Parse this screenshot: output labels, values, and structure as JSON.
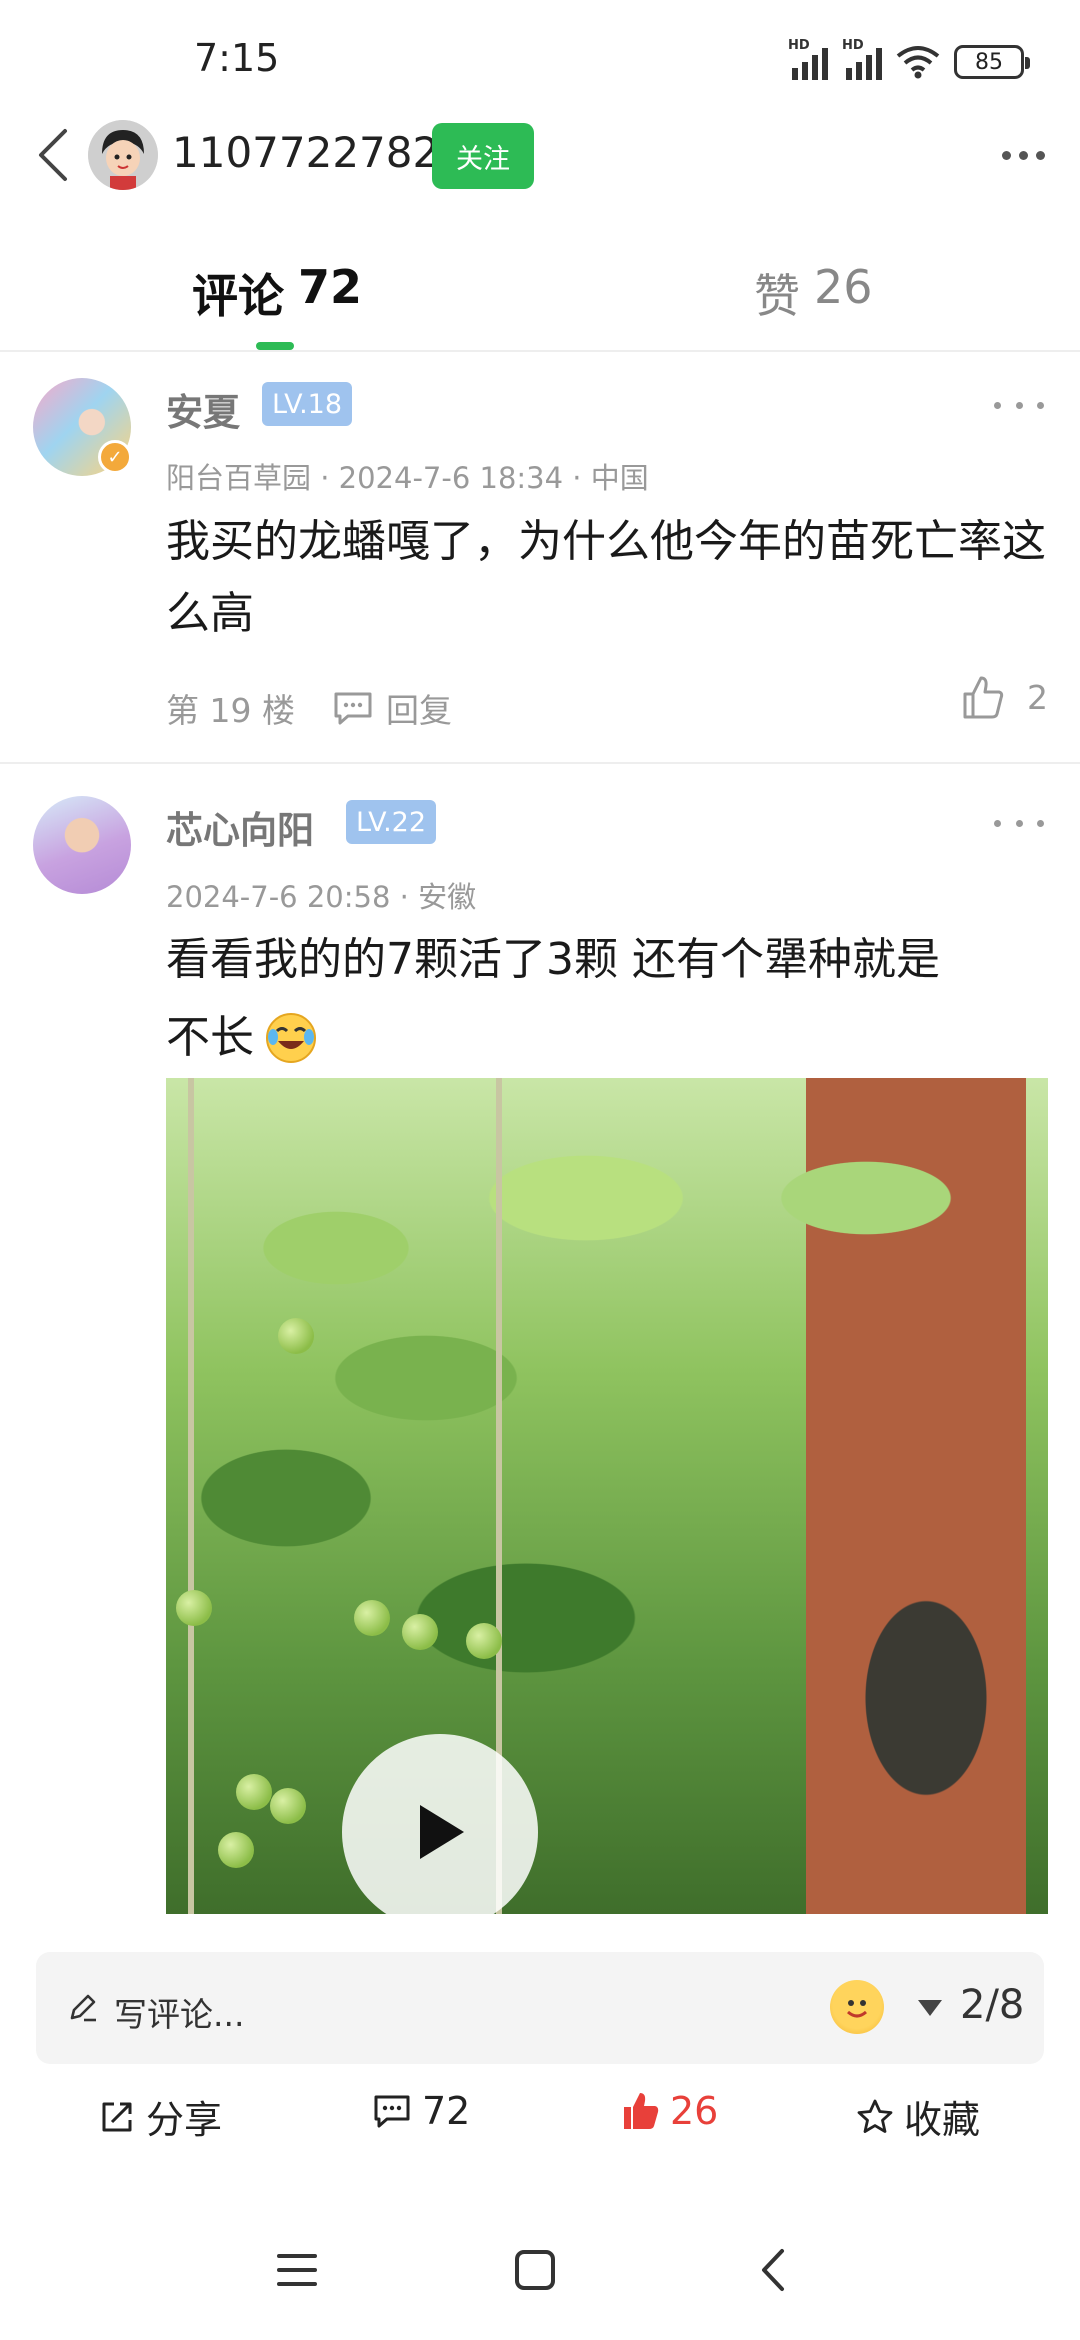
{
  "status_bar": {
    "time": "7:15",
    "battery": "85",
    "signal_label": "HD"
  },
  "header": {
    "username": "1107722782",
    "follow_label": "关注"
  },
  "tabs": [
    {
      "label": "评论",
      "count": "72",
      "active": true
    },
    {
      "label": "赞",
      "count": "26",
      "active": false
    }
  ],
  "comments": [
    {
      "name": "安夏",
      "level": "LV.18",
      "meta": "阳台百草园 · 2024-7-6 18:34 · 中国",
      "text": "我买的龙蟠嘎了，为什么他今年的苗死亡率这么高",
      "floor": "第 19 楼",
      "reply_label": "回复",
      "likes": "2",
      "verified_icon": "verified-badge-icon"
    },
    {
      "name": "芯心向阳",
      "level": "LV.22",
      "meta": "2024-7-6 20:58 · 安徽",
      "text_line1": "看看我的的7颗活了3颗 还有个犟种就是",
      "text_line2": "不长",
      "has_video": true
    }
  ],
  "bottom_bar": {
    "write_placeholder": "写评论...",
    "page_indicator": "2/8",
    "share_label": "分享",
    "comment_count": "72",
    "like_count": "26",
    "favorite_label": "收藏",
    "like_color": "#e8403a"
  },
  "colors": {
    "accent_green": "#2dbb55",
    "level_badge": "#9fc3ee"
  }
}
